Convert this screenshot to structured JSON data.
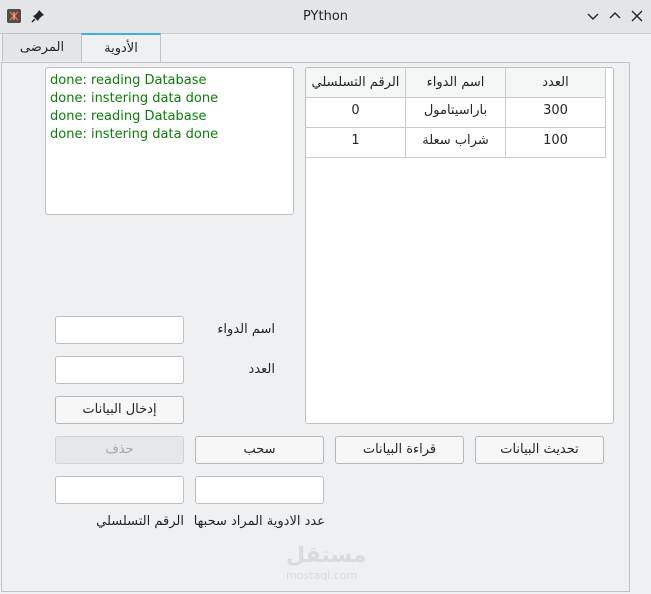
{
  "window": {
    "title": "PYthon"
  },
  "tabs": [
    {
      "label": "المرضى",
      "active": false
    },
    {
      "label": "الأدوية",
      "active": true
    }
  ],
  "log": {
    "lines": [
      "done: reading Database",
      "done: instering data done",
      "done: reading Database",
      "done: instering data done"
    ]
  },
  "table": {
    "columns": [
      "الرقم التسلسلي",
      "اسم الدواء",
      "العدد"
    ],
    "rows": [
      [
        "0",
        "باراسيتامول",
        "300"
      ],
      [
        "1",
        "شراب سعلة",
        "100"
      ]
    ]
  },
  "form": {
    "drug_name_label": "اسم الدواء",
    "quantity_label": "العدد",
    "insert_button": "إدخال البيانات",
    "delete_button": "حذف",
    "withdraw_button": "سحب",
    "read_button": "قراءة البيانات",
    "update_button": "تحديث البيانات",
    "withdraw_quantity_label": "عدد الادوية المراد سحبها",
    "serial_label": "الرقم التسلسلي"
  },
  "watermark": {
    "logo": "مستقل",
    "sub": "mostaql.com"
  },
  "colors": {
    "accent": "#3daee9",
    "log_text": "#0a7d0a"
  }
}
